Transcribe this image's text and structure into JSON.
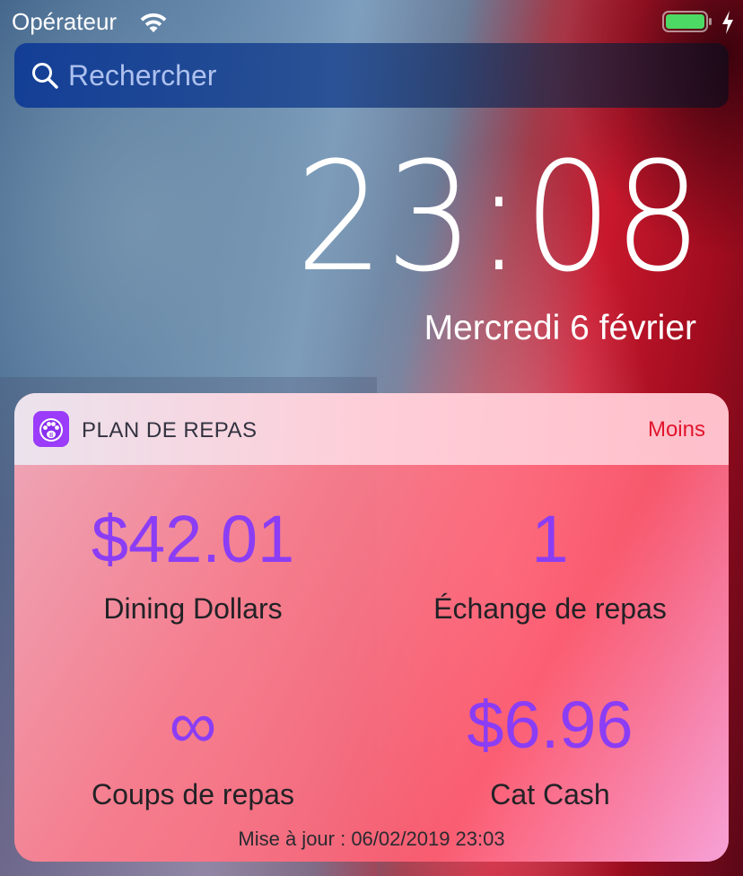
{
  "status_bar": {
    "carrier": "Opérateur"
  },
  "search": {
    "placeholder": "Rechercher"
  },
  "lock_screen": {
    "time": "23:08",
    "date": "Mercredi 6 février"
  },
  "widget": {
    "app_name": "PLAN DE REPAS",
    "less_label": "Moins",
    "stats": [
      {
        "value": "$42.01",
        "label": "Dining Dollars"
      },
      {
        "value": "1",
        "label": "Échange de repas"
      },
      {
        "value": "∞",
        "label": "Coups de repas"
      },
      {
        "value": "$6.96",
        "label": "Cat Cash"
      }
    ],
    "updated": "Mise à jour : 06/02/2019 23:03"
  },
  "colors": {
    "accent_purple": "#8b3df5",
    "less_red": "#e2142d",
    "battery_green": "#4cd964"
  },
  "icons": [
    "wifi-icon",
    "battery-icon",
    "charging-bolt-icon",
    "search-icon",
    "paw-app-icon"
  ]
}
